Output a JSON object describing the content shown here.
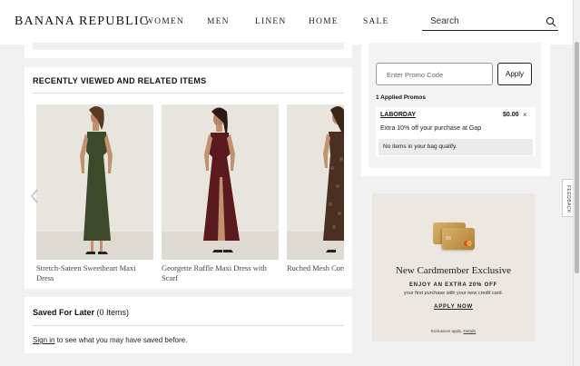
{
  "header": {
    "logo": "BANANA REPUBLIC",
    "nav": [
      "WOMEN",
      "MEN",
      "LINEN",
      "HOME",
      "SALE"
    ],
    "search_placeholder": "Search"
  },
  "feedback": {
    "label": "FEEDBACK"
  },
  "recently_viewed": {
    "title": "RECENTLY VIEWED AND RELATED ITEMS",
    "products": [
      {
        "name": "Stretch-Sateen Sweetheart Maxi Dress",
        "dress_color": "#3d4a2a"
      },
      {
        "name": "Georgette Ruffle Maxi Dress with Scarf",
        "dress_color": "#5a1a1e"
      },
      {
        "name": "Ruched Mesh Corset Maxi Dress",
        "dress_color": "#4a3020"
      }
    ]
  },
  "saved_for_later": {
    "title": "Saved For Later",
    "count": "(0 Items)",
    "signin_link": "Sign in",
    "message": " to see what you may have saved before."
  },
  "promo": {
    "input_placeholder": "Enter Promo Code",
    "apply_label": "Apply",
    "applied_label": "1 Applied Promos",
    "code": "LABORDAY",
    "amount": "$0.00",
    "close": "×",
    "description": "Extra 10% off your purchase at Gap",
    "note": "No items in your bag qualify."
  },
  "ad": {
    "title": "New Cardmember Exclusive",
    "subtitle": "ENJOY AN EXTRA 20% OFF",
    "subtitle2": "your first purchase with your new credit card.",
    "cta": "APPLY NOW",
    "fine_prefix": "Exclusions apply. ",
    "fine_link": "Details",
    "card_color": "#c9a15a"
  }
}
